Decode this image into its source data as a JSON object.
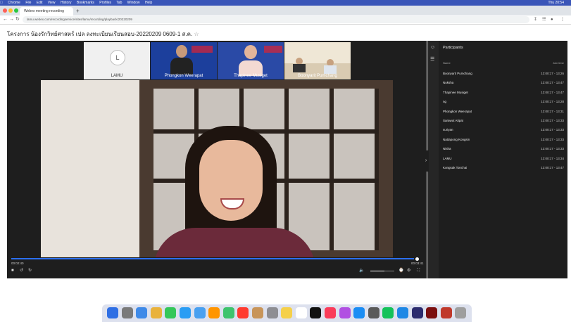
{
  "menubar": {
    "items": [
      "Chrome",
      "File",
      "Edit",
      "View",
      "History",
      "Bookmarks",
      "Profiles",
      "Tab",
      "Window",
      "Help"
    ],
    "clock": "Thu 20:54"
  },
  "browser": {
    "tab_title": "Webex meeting recording",
    "url": "lamu.webex.com/recordingservice/sites/lamu/recording/playback/20220209"
  },
  "page": {
    "title": "โครงการ น้องรักวิทย์ศาสตร์ เปล ลงทะเบียนเรียนสอบ-20220209 0609-1 ส.ค.",
    "title_suffix": "☆"
  },
  "thumbnails": [
    {
      "name": "LAMU",
      "initial": "L"
    },
    {
      "name": "Phongkon Weerapat"
    },
    {
      "name": "Thapinee Musiget"
    },
    {
      "name": "Boonyarit Pumchang"
    }
  ],
  "controls": {
    "elapsed": "00:02:40",
    "duration": "00:03:41",
    "progress": 0.99,
    "volume": 0.6
  },
  "participants": {
    "title": "Participants",
    "col_name": "Name",
    "col_time": "Join time",
    "rows": [
      {
        "name": "Boonyarit Pumchang",
        "time": "13:00:17 - 13:26"
      },
      {
        "name": "Nuksha",
        "time": "13:00:17 - 13:47"
      },
      {
        "name": "Thapinee Musiget",
        "time": "13:00:17 - 13:47"
      },
      {
        "name": "ng",
        "time": "13:00:17 - 13:28"
      },
      {
        "name": "Phongkon Weerapat",
        "time": "13:00:17 - 13:31"
      },
      {
        "name": "Sarawut Atipat",
        "time": "13:00:17 - 13:33"
      },
      {
        "name": "suriyan",
        "time": "13:00:17 - 13:33"
      },
      {
        "name": "Nattapong Kongsin",
        "time": "13:00:17 - 13:33"
      },
      {
        "name": "Nisha",
        "time": "13:00:17 - 13:33"
      },
      {
        "name": "LAMU",
        "time": "13:00:17 - 13:34"
      },
      {
        "name": "Kongsak Tonchai",
        "time": "13:00:17 - 13:47"
      }
    ]
  },
  "colors": {
    "menubar": "#3a55b8",
    "progress": "#2b6ff0",
    "player_bg": "#1e1e1e"
  }
}
